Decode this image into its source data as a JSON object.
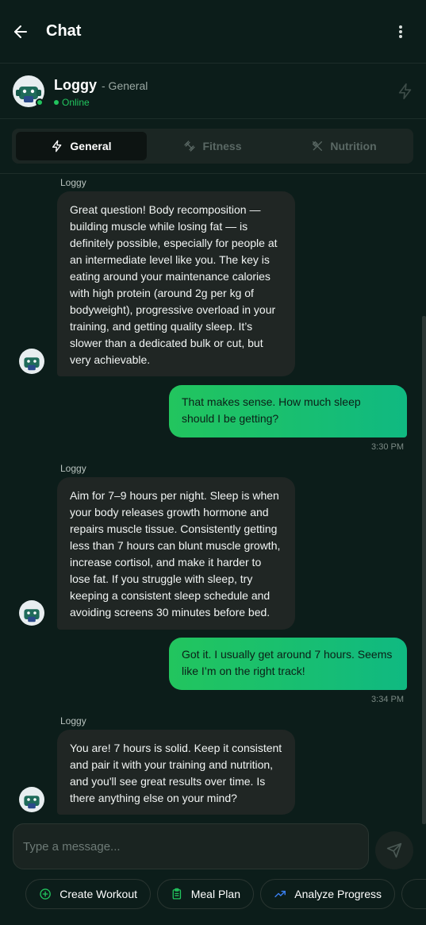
{
  "header": {
    "title": "Chat"
  },
  "assistant": {
    "name": "Loggy",
    "mode": "- General",
    "status": "Online"
  },
  "tabs": [
    {
      "label": "General",
      "icon": "bolt-icon",
      "active": true
    },
    {
      "label": "Fitness",
      "icon": "dumbbell-icon",
      "active": false
    },
    {
      "label": "Nutrition",
      "icon": "utensils-icon",
      "active": false
    }
  ],
  "messages": [
    {
      "role": "assistant",
      "sender": "Loggy",
      "text": "Great question! Body recomposition — building muscle while losing fat — is definitely possible, especially for people at an intermediate level like you. The key is eating around your maintenance calories with high protein (around 2g per kg of bodyweight), progressive overload in your training, and getting quality sleep. It’s slower than a dedicated bulk or cut, but very achievable."
    },
    {
      "role": "user",
      "text": "That makes sense. How much sleep should I be getting?",
      "time": "3:30 PM"
    },
    {
      "role": "assistant",
      "sender": "Loggy",
      "text": "Aim for 7–9 hours per night. Sleep is when your body releases growth hormone and repairs muscle tissue. Consistently getting less than 7 hours can blunt muscle growth, increase cortisol, and make it harder to lose fat. If you struggle with sleep, try keeping a consistent sleep schedule and avoiding screens 30 minutes before bed."
    },
    {
      "role": "user",
      "text": "Got it. I usually get around 7 hours. Seems like I’m on the right track!",
      "time": "3:34 PM"
    },
    {
      "role": "assistant",
      "sender": "Loggy",
      "text": "You are! 7 hours is solid. Keep it consistent and pair it with your training and nutrition, and you'll see great results over time. Is there anything else on your mind?"
    }
  ],
  "composer": {
    "placeholder": "Type a message..."
  },
  "quick_actions": [
    {
      "label": "Create Workout",
      "icon": "plus-circle-icon"
    },
    {
      "label": "Meal Plan",
      "icon": "clipboard-icon"
    },
    {
      "label": "Analyze Progress",
      "icon": "trending-up-icon"
    }
  ],
  "colors": {
    "background": "#0c1d1a",
    "accent": "#22c55e",
    "bubble_ai": "#202624",
    "bubble_user": "#10b981"
  }
}
